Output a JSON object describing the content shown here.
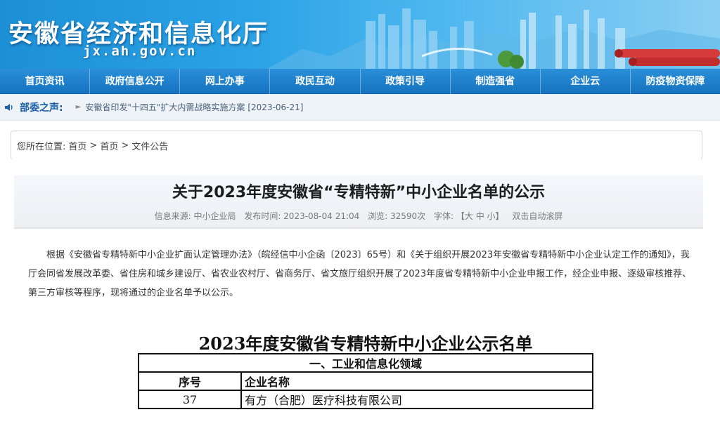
{
  "header": {
    "site_title": "安徽省经济和信息化厅",
    "site_domain": "jx.ah.gov.cn"
  },
  "nav": {
    "items": [
      {
        "label": "首页资讯"
      },
      {
        "label": "政府信息公开"
      },
      {
        "label": "网上办事"
      },
      {
        "label": "政民互动"
      },
      {
        "label": "政策引导"
      },
      {
        "label": "制造强省"
      },
      {
        "label": "企业云"
      },
      {
        "label": "防疫物资保障"
      }
    ]
  },
  "notice": {
    "label": "部委之声:",
    "text": "安徽省印发\"十四五\"扩大内需战略实施方案",
    "date": "[2023-06-21]"
  },
  "breadcrumb": {
    "prefix": "您所在位置:",
    "items": [
      "首页",
      ">",
      "首页",
      ">",
      "文件公告"
    ]
  },
  "article": {
    "title": "关于2023年度安徽省“专精特新”中小企业名单的公示",
    "meta": {
      "source": "信息来源: 中小企业局",
      "published": "发布时间: 2023-08-04 21:04",
      "views": "浏览: 32590次",
      "font_label": "字体: 【大 中 小】",
      "autoscroll": "双击自动滚屏"
    },
    "body": "根据《安徽省专精特新中小企业扩面认定管理办法》（皖经信中小企函〔2023〕65号）和《关于组织开展2023年安徽省专精特新中小企业认定工作的通知》，我厅会同省发展改革委、省住房和城乡建设厅、省农业农村厅、省商务厅、省文旅厅组织开展了2023年度省专精特新中小企业申报工作，经企业申报、逐级审核推荐、第三方审核等程序，现将通过的企业名单予以公示。"
  },
  "document": {
    "title": "2023年度安徽省专精特新中小企业公示名单",
    "section": "一、工业和信息化领域",
    "headers": [
      "序号",
      "企业名称"
    ],
    "rows": [
      [
        "37",
        "有方（合肥）医疗科技有限公司"
      ]
    ]
  },
  "colors": {
    "nav_bg": "#1673c0",
    "notice_label": "#1a5fa8",
    "banner_start": "#1d8fd6"
  }
}
